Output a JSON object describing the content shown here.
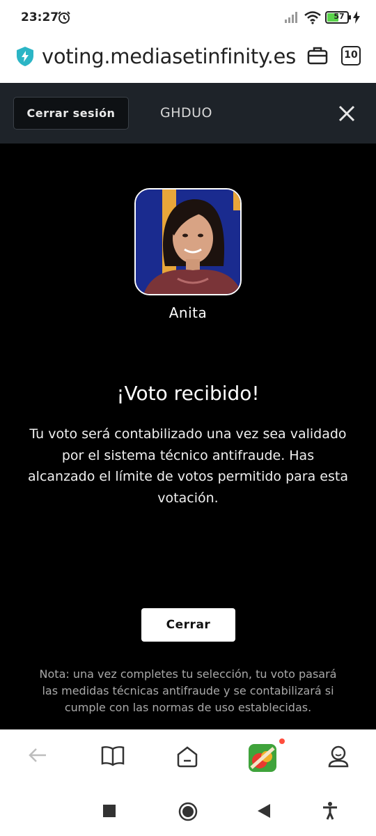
{
  "status_bar": {
    "time": "23:27",
    "battery": "57"
  },
  "browser": {
    "url": "voting.mediasetinfinity.es/",
    "tab_count": "10"
  },
  "header": {
    "logout_label": "Cerrar sesión",
    "program": "GHDUO"
  },
  "candidate": {
    "name": "Anita"
  },
  "result": {
    "heading": "¡Voto recibido!",
    "message": "Tu voto será contabilizado una vez sea validado por el sistema técnico antifraude. Has alcanzado el límite de votos permitido para esta votación."
  },
  "close_label": "Cerrar",
  "note": "Nota: una vez completes tu selección, tu voto pasará las medidas técnicas antifraude y se contabilizará si cumple con las normas de uso establecidas.",
  "colors": {
    "header_bg": "#1e2329",
    "page_bg": "#000000",
    "note_text": "#a9a9a9"
  },
  "icons": {
    "bottom_bar": [
      "back-arrow-icon",
      "book-icon",
      "home-icon",
      "game-icon",
      "profile-icon"
    ],
    "system_nav": [
      "recents-icon",
      "home-circle-icon",
      "back-triangle-icon",
      "accessibility-icon"
    ]
  }
}
